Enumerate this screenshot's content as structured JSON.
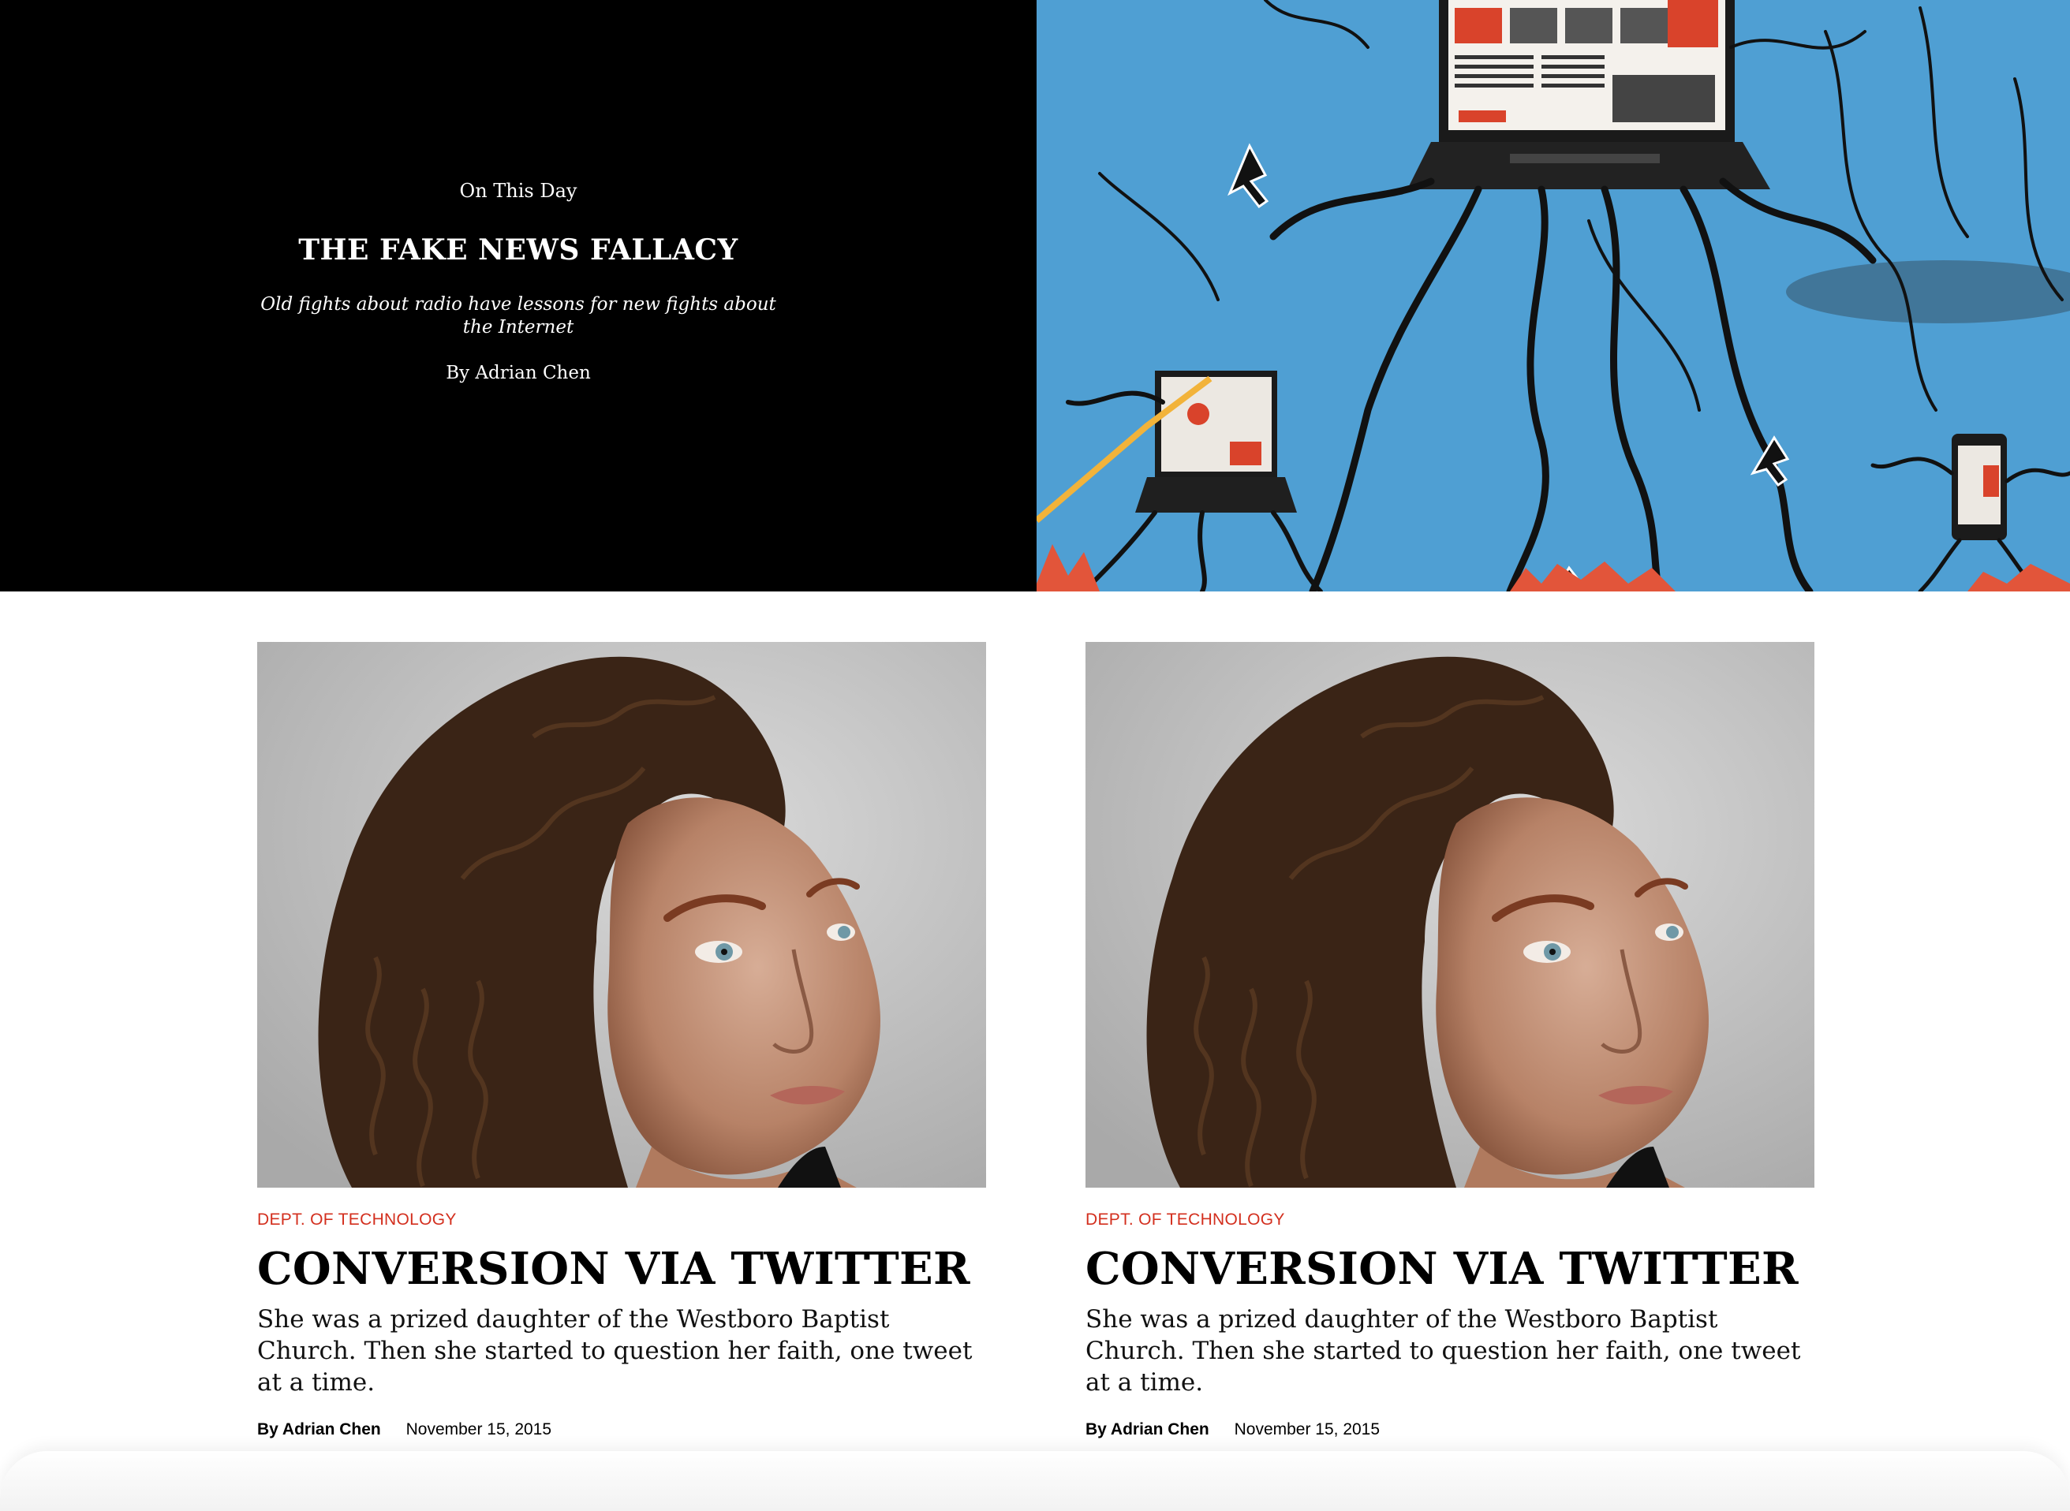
{
  "hero": {
    "kicker": "On This Day",
    "title": "THE FAKE NEWS FALLACY",
    "dek": "Old fights about radio have lessons for new fights about the Internet",
    "byline": "By Adrian Chen",
    "illustration": "laptops-with-tentacle-legs-illustration",
    "bg_color": "#000000",
    "illustration_bg": "#4f9fd3"
  },
  "cards": [
    {
      "rubric": "DEPT. OF TECHNOLOGY",
      "headline": "CONVERSION VIA TWITTER",
      "dek": "She was a prized daughter of the Westboro Baptist Church. Then she started to question her faith, one tweet at a time.",
      "author": "By Adrian Chen",
      "date": "November 15, 2015",
      "image": "portrait-woman-curly-hair"
    },
    {
      "rubric": "DEPT. OF TECHNOLOGY",
      "headline": "CONVERSION VIA TWITTER",
      "dek": "She was a prized daughter of the Westboro Baptist Church. Then she started to question her faith, one tweet at a time.",
      "author": "By Adrian Chen",
      "date": "November 15, 2015",
      "image": "portrait-woman-curly-hair"
    }
  ],
  "colors": {
    "rubric": "#d32f1e"
  }
}
